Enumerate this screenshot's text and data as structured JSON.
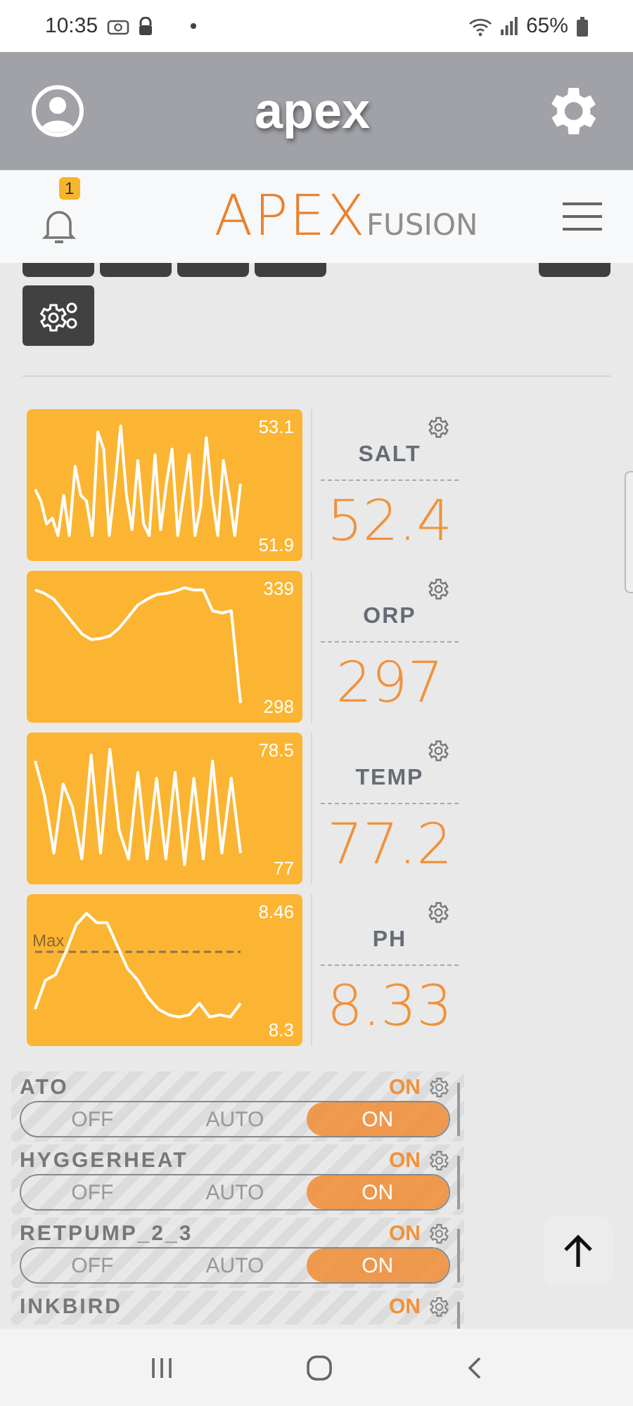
{
  "status_bar": {
    "time": "10:35",
    "battery": "65%"
  },
  "header": {
    "title": "apex"
  },
  "logo_bar": {
    "notifications": "1",
    "logo": "APEX",
    "logo_suffix": "FUSION"
  },
  "probes": [
    {
      "name": "SALT",
      "value": "52.4",
      "max": "53.1",
      "min": "51.9"
    },
    {
      "name": "ORP",
      "value": "297",
      "max": "339",
      "min": "298"
    },
    {
      "name": "TEMP",
      "value": "77.2",
      "max": "78.5",
      "min": "77"
    },
    {
      "name": "PH",
      "value": "8.33",
      "max": "8.46",
      "min": "8.3",
      "marker": "Max"
    }
  ],
  "outputs": [
    {
      "name": "ATO",
      "status": "ON",
      "modes": [
        {
          "label": "OFF",
          "selected": false
        },
        {
          "label": "AUTO",
          "selected": false
        },
        {
          "label": "ON",
          "selected": true
        }
      ]
    },
    {
      "name": "HYGGERHEAT",
      "status": "ON",
      "modes": [
        {
          "label": "OFF",
          "selected": false
        },
        {
          "label": "AUTO",
          "selected": false
        },
        {
          "label": "ON",
          "selected": true
        }
      ]
    },
    {
      "name": "RETPUMP_2_3",
      "status": "ON",
      "modes": [
        {
          "label": "OFF",
          "selected": false
        },
        {
          "label": "AUTO",
          "selected": false
        },
        {
          "label": "ON",
          "selected": true
        }
      ]
    },
    {
      "name": "INKBIRD",
      "status": "ON"
    }
  ]
}
